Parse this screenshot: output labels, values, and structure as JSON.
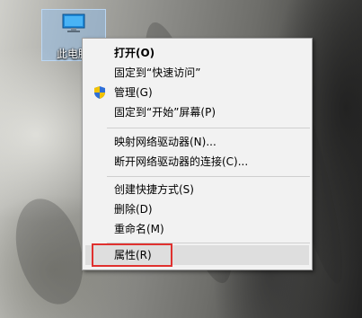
{
  "desktop": {
    "icon_label": "此电脑",
    "icon_name": "computer-icon"
  },
  "menu": {
    "items": [
      {
        "label": "打开(O)"
      },
      {
        "label": "固定到“快速访问”"
      },
      {
        "label": "管理(G)",
        "icon": "shield-icon"
      },
      {
        "label": "固定到“开始”屏幕(P)"
      },
      {
        "label": "映射网络驱动器(N)..."
      },
      {
        "label": "断开网络驱动器的连接(C)..."
      },
      {
        "label": "创建快捷方式(S)"
      },
      {
        "label": "删除(D)"
      },
      {
        "label": "重命名(M)"
      },
      {
        "label": "属性(R)"
      }
    ],
    "highlighted_item": "属性(R)"
  },
  "colors": {
    "highlight_border": "#e0312f",
    "menu_background": "#f2f2f2",
    "shield_blue": "#2f6fd6",
    "shield_yellow": "#f2c200"
  }
}
